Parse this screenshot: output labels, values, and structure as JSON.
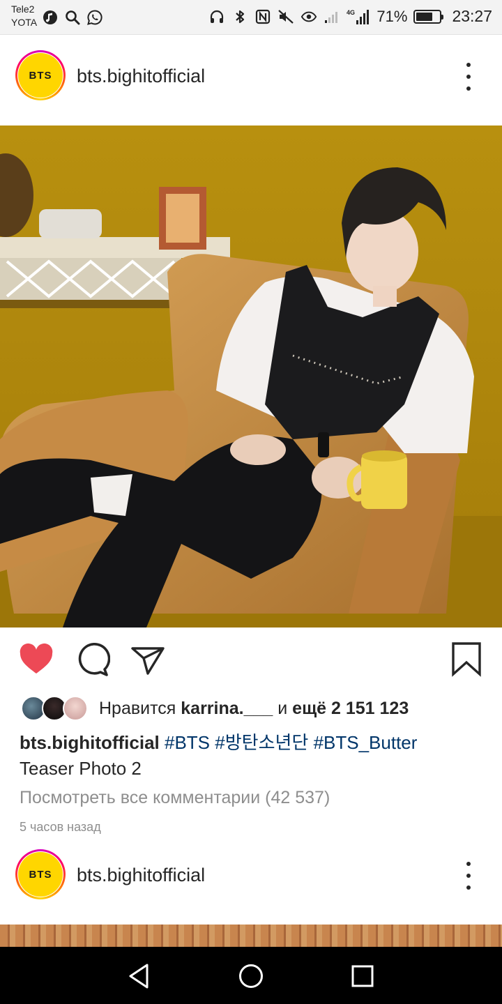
{
  "status_bar": {
    "carrier_1": "Tele2",
    "carrier_2": "YOTA",
    "network": "4G",
    "battery": "71%",
    "battery_level": 0.71,
    "time": "23:27",
    "icons": [
      "music-icon",
      "search-icon",
      "whatsapp-icon",
      "headphones-icon",
      "bluetooth-icon",
      "nfc-icon",
      "mute-icon",
      "eye-icon",
      "wifi-signal-icon",
      "cell-signal-icon",
      "battery-icon"
    ]
  },
  "post": {
    "avatar_text": "BTS",
    "username": "bts.bighitofficial",
    "likes": {
      "prefix": "Нравится ",
      "liker": "karrina.___",
      "middle": " и ",
      "count_text": "ещё 2 151 123"
    },
    "caption": {
      "username": "bts.bighitofficial",
      "tags": [
        "#BTS",
        "#방탄소년단",
        "#BTS_Butter"
      ],
      "text": "Teaser Photo 2"
    },
    "comments_link": "Посмотреть все комментарии (42 537)",
    "time_ago": "5 часов назад",
    "liked": true,
    "colors": {
      "like": "#ed4956",
      "link": "#003569",
      "muted": "#8e8e8e"
    }
  },
  "next_post": {
    "avatar_text": "BTS",
    "username": "bts.bighitofficial"
  },
  "nav_bar": {
    "buttons": [
      "back-icon",
      "home-icon",
      "recents-icon"
    ]
  }
}
